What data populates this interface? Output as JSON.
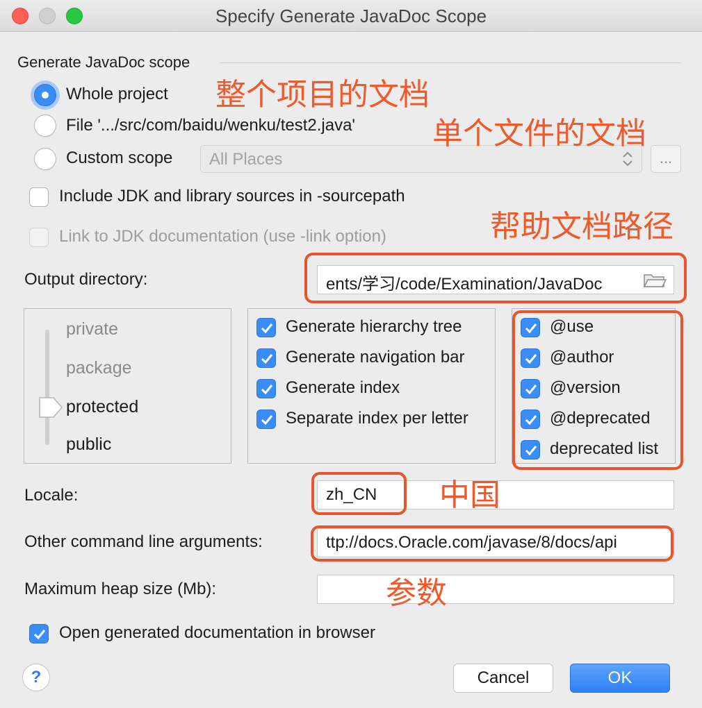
{
  "window": {
    "title": "Specify Generate JavaDoc Scope"
  },
  "scope": {
    "heading": "Generate JavaDoc scope",
    "whole_project": "Whole project",
    "file": "File '.../src/com/baidu/wenku/test2.java'",
    "custom_scope": "Custom scope",
    "custom_scope_value": "All Places",
    "dots_label": "...",
    "selected": "whole_project"
  },
  "options": {
    "include_jdk": "Include JDK and library sources in -sourcepath",
    "link_jdk": "Link to JDK documentation (use -link option)"
  },
  "output": {
    "label": "Output directory:",
    "value": "ents/学习/code/Examination/JavaDoc"
  },
  "visibility": {
    "items": [
      "private",
      "package",
      "protected",
      "public"
    ],
    "selected": "protected"
  },
  "generate": {
    "items": [
      "Generate hierarchy tree",
      "Generate navigation bar",
      "Generate index",
      "Separate index per letter"
    ]
  },
  "tags": {
    "items": [
      "@use",
      "@author",
      "@version",
      "@deprecated",
      "deprecated list"
    ]
  },
  "locale": {
    "label": "Locale:",
    "value": "zh_CN"
  },
  "args": {
    "label": "Other command line arguments:",
    "value": "ttp://docs.Oracle.com/javase/8/docs/api"
  },
  "heap": {
    "label": "Maximum heap size (Mb):",
    "value": ""
  },
  "open_browser": "Open generated documentation in browser",
  "buttons": {
    "help": "?",
    "cancel": "Cancel",
    "ok": "OK"
  },
  "annotations": {
    "whole_project": "整个项目的文档",
    "single_file": "单个文件的文档",
    "help_doc_path": "帮助文档路径",
    "china": "中国",
    "params": "参数"
  },
  "colors": {
    "accent": "#3a8df7",
    "annotation": "#ee5a2b"
  }
}
